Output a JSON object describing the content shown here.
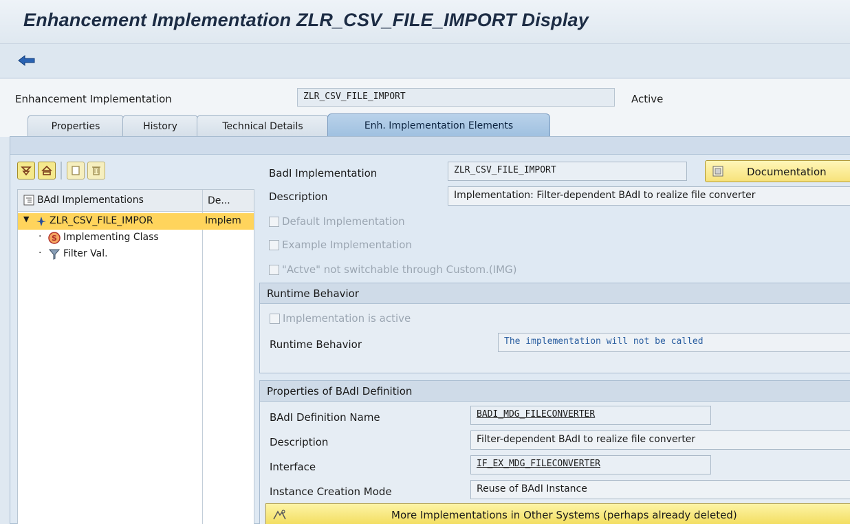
{
  "window": {
    "title": "Enhancement Implementation ZLR_CSV_FILE_IMPORT Display"
  },
  "header": {
    "label": "Enhancement Implementation",
    "value": "ZLR_CSV_FILE_IMPORT",
    "status": "Active"
  },
  "tabs": [
    {
      "label": "Properties"
    },
    {
      "label": "History"
    },
    {
      "label": "Technical Details"
    },
    {
      "label": "Enh. Implementation Elements",
      "active": true
    }
  ],
  "tree": {
    "col1": "BAdI Implementations",
    "col2": "De...",
    "rows": [
      {
        "label": "ZLR_CSV_FILE_IMPOR",
        "desc": "Implem"
      },
      {
        "label": "Implementing Class",
        "desc": ""
      },
      {
        "label": "Filter Val.",
        "desc": ""
      }
    ]
  },
  "detail": {
    "badi_impl_label": "BadI Implementation",
    "badi_impl_value": "ZLR_CSV_FILE_IMPORT",
    "doc_button": "Documentation",
    "desc_label": "Description",
    "desc_value": "Implementation:  Filter-dependent BAdI to realize file converter",
    "chk_default": "Default Implementation",
    "chk_example": "Example Implementation",
    "chk_active_custom": "\"Actve\" not switchable through Custom.(IMG)"
  },
  "runtime": {
    "header": "Runtime Behavior",
    "chk_active": "Implementation is active",
    "label": "Runtime Behavior",
    "value": "The implementation will not be called"
  },
  "definition": {
    "header": "Properties of BAdI Definition",
    "name_label": "BAdI Definition Name",
    "name_value": "BADI_MDG_FILECONVERTER",
    "desc_label": "Description",
    "desc_value": "Filter-dependent BAdI to realize file converter",
    "iface_label": "Interface",
    "iface_value": "IF_EX_MDG_FILECONVERTER",
    "mode_label": "Instance Creation Mode",
    "mode_value": "Reuse of BAdI Instance"
  },
  "more_button": "More Implementations in Other Systems (perhaps already deleted)",
  "colors": {
    "accent": "#9fc0e0",
    "highlight": "#ffd45c",
    "button": "#f7e27a"
  }
}
